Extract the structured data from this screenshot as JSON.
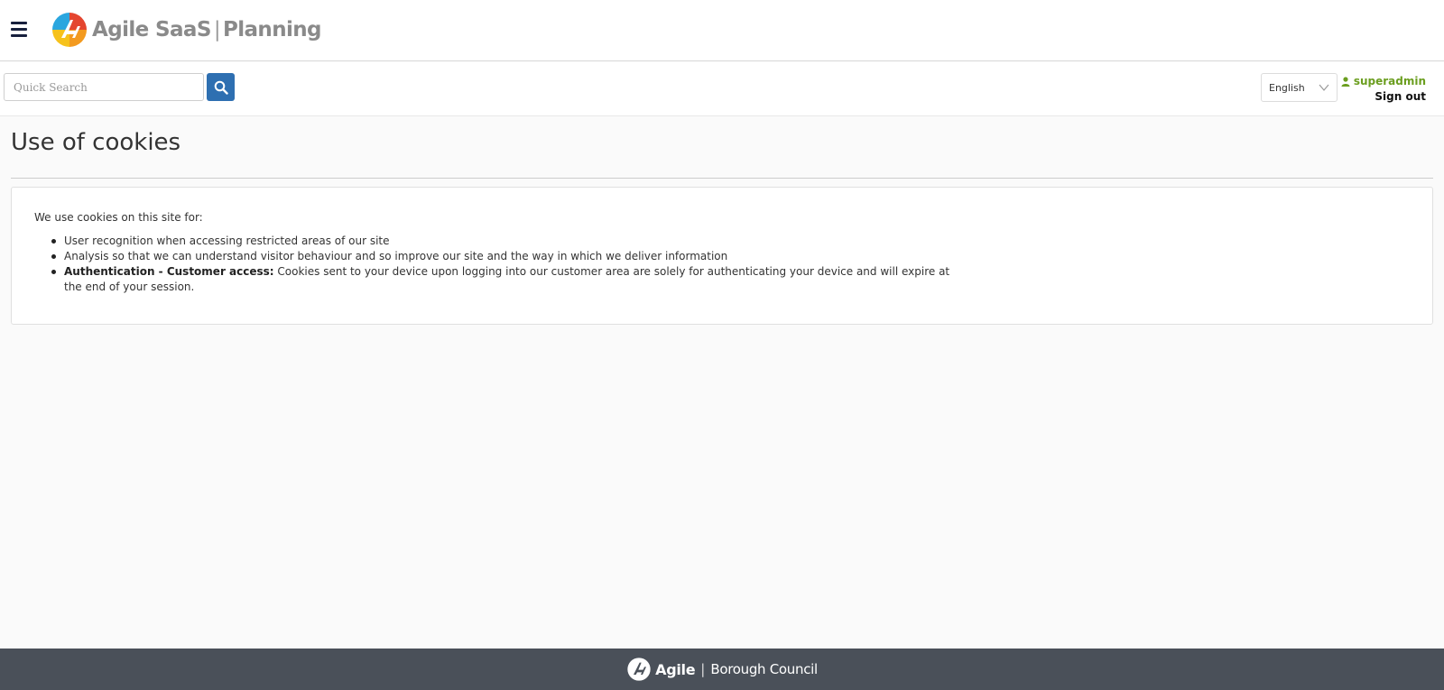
{
  "header": {
    "brand_name": "Agile SaaS",
    "brand_product": "Planning",
    "menu_icon": "hamburger-icon",
    "logo_icon": "agile-logo-icon"
  },
  "toolbar": {
    "search_placeholder": "Quick Search",
    "search_value": "",
    "search_icon": "search-icon",
    "language": "English",
    "username": "superadmin",
    "user_icon": "user-icon",
    "signout_label": "Sign out"
  },
  "page": {
    "title": "Use of cookies",
    "intro": "We use cookies on this site for:",
    "items": [
      {
        "bold": "",
        "text": "User recognition when accessing restricted areas of our site"
      },
      {
        "bold": "",
        "text": "Analysis so that we can understand visitor behaviour and so improve our site and the way in which we deliver information"
      },
      {
        "bold": "Authentication - Customer access:",
        "text": " Cookies sent to your device upon logging into our customer area are solely for authenticating your device and will expire at the end of your session."
      }
    ]
  },
  "footer": {
    "brand": "Agile",
    "council": "Borough Council"
  },
  "colors": {
    "accent": "#2e6fb1",
    "user_green": "#6b9e1f",
    "footer_bg": "#4a5059"
  }
}
